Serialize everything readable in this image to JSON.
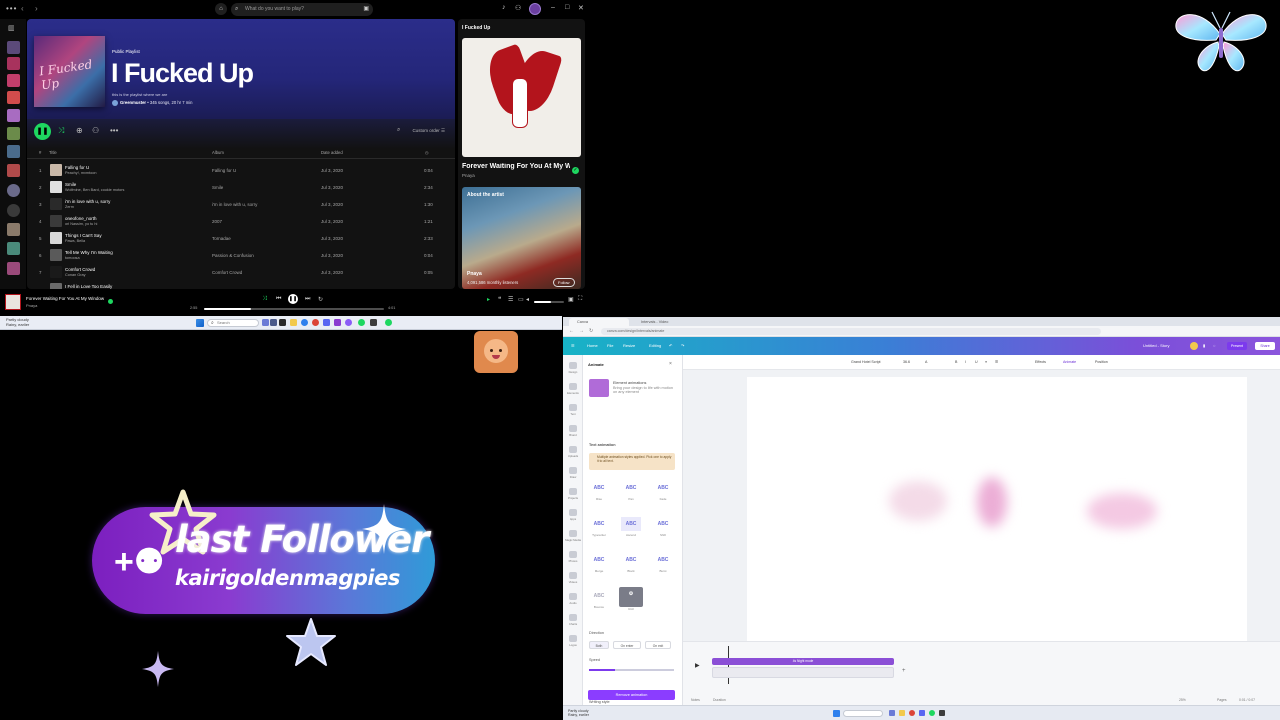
{
  "spotify": {
    "search_placeholder": "What do you want to play?",
    "playlist_type": "Public Playlist",
    "playlist_title": "I Fucked Up",
    "playlist_desc": "this is the playlist where we are",
    "owner": "Greenmuster",
    "stats": "• 345 songs, 20 hr 7 min",
    "sort_label": "Custom order",
    "columns": {
      "num": "#",
      "title": "Title",
      "album": "Album",
      "date": "Date added"
    },
    "tracks": [
      {
        "n": "1",
        "title": "Falling for U",
        "artist": "Peachy!, mxmtoon",
        "album": "Falling for U",
        "date": "Jul 3, 2020",
        "dur": "0:04"
      },
      {
        "n": "2",
        "title": "Smile",
        "artist": "Wolfmine, Ben Bard, cookie motors",
        "album": "Smile",
        "date": "Jul 3, 2020",
        "dur": "2:34"
      },
      {
        "n": "3",
        "title": "i'm in love with u, sorry",
        "artist": "Zerm",
        "album": "i'm in love with u, sorry",
        "date": "Jul 3, 2020",
        "dur": "1:30"
      },
      {
        "n": "4",
        "title": "oneofone_north",
        "artist": "ori Nassim, yo tu hi",
        "album": "2007",
        "date": "Jul 3, 2020",
        "dur": "1:21"
      },
      {
        "n": "5",
        "title": "Things I Can't Say",
        "artist": "Pawa, Bella",
        "album": "Tornadae",
        "date": "Jul 3, 2020",
        "dur": "2:33"
      },
      {
        "n": "6",
        "title": "Tell Me Why I'm Waiting",
        "artist": "tomoosa",
        "album": "Passion & Confusion",
        "date": "Jul 3, 2020",
        "dur": "0:04"
      },
      {
        "n": "7",
        "title": "Comfort Crowd",
        "artist": "Conan Gray",
        "album": "Comfort Crowd",
        "date": "Jul 3, 2020",
        "dur": "0:05"
      },
      {
        "n": "8",
        "title": "I Fell in Love Too Easily",
        "artist": "",
        "album": "",
        "date": "",
        "dur": ""
      }
    ],
    "right_title": "I Fucked Up",
    "now_song": "Forever Waiting For You At My Window",
    "now_artist": "Pnaya",
    "about_label": "About the artist",
    "about_name": "Pnaya",
    "about_listeners": "4,091,586 monthly listeners",
    "follow_label": "Follow",
    "bar_song": "Forever Waiting For You At My Window",
    "bar_artist": "Pnaya",
    "time_elapsed": "2:55",
    "time_total": "4:01",
    "progress": 0.26,
    "volume": 0.55
  },
  "taskbar_left": {
    "weather_line1": "Partly cloudy",
    "weather_line2": "Rainy, earlier",
    "search": "Search"
  },
  "overlay": {
    "title": "last Follower",
    "username": "kairigoldenmagpies"
  },
  "canva": {
    "tabs": [
      "Canva",
      "Intervals - Video"
    ],
    "url": "canva.com/design/Intervals/animate",
    "header_items": [
      "Home",
      "File",
      "Resize",
      "Editing"
    ],
    "design_name": "Untitled - Story",
    "present": "Present",
    "share": "Share",
    "rail": [
      "Design",
      "Elements",
      "Text",
      "Brand",
      "Uploads",
      "Draw",
      "Projects",
      "Apps",
      "Magic Media",
      "Photos",
      "Videos",
      "Audio",
      "Charts",
      "Logos"
    ],
    "panel_title": "Animate",
    "element_label": "Element animations",
    "element_desc": "Bring your design to life with motion on any element",
    "section_text": "Text animation",
    "warning": "Multiple animation styles applied. Pick one to apply it to all text.",
    "animations": [
      "Rise",
      "Pan",
      "Fade",
      "Typewriter",
      "Ascend",
      "Shift",
      "Merge",
      "Block",
      "Burst",
      "Bounce",
      "Roll",
      "Skate",
      "Spread",
      "Scrub"
    ],
    "direction_label": "Direction",
    "btn_both": "Both",
    "btn_enter": "On enter",
    "btn_exit": "On exit",
    "speed_label": "Speed",
    "speed": 0.3,
    "writing_label": "Writing style",
    "remove": "Remove animation",
    "toolbar": [
      "Grand Hotel Script",
      "36.6",
      "A",
      "Effects",
      "Animate",
      "Position"
    ],
    "clip_label": "4s  Night mode",
    "status_left": "Notes",
    "status_duration": "Duration",
    "zoom": "25%",
    "pages": "Pages",
    "time": "0:01 / 0:07"
  }
}
